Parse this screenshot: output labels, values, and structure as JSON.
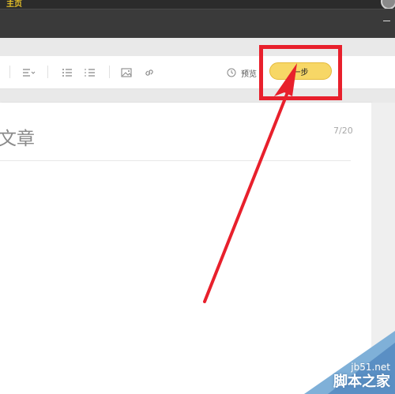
{
  "window": {
    "home_tab_label": "主页"
  },
  "toolbar": {
    "items": [
      "align-left-icon",
      "bullet-list-icon",
      "numbered-list-icon",
      "image-icon",
      "link-icon"
    ],
    "preview_label": "预览",
    "next_label": "一步"
  },
  "editor": {
    "title_text": "文章",
    "title_counter": "7/20"
  },
  "watermark": {
    "site": "jb51.net",
    "name": "脚本之家"
  },
  "colors": {
    "next_button": "#f7d766",
    "annotation_red": "#e8202c",
    "titlebar": "#3a3a3a"
  }
}
